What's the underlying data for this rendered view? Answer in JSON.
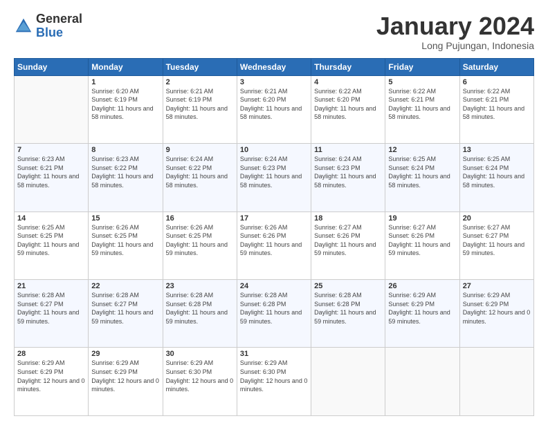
{
  "header": {
    "logo_general": "General",
    "logo_blue": "Blue",
    "month_title": "January 2024",
    "location": "Long Pujungan, Indonesia"
  },
  "days_of_week": [
    "Sunday",
    "Monday",
    "Tuesday",
    "Wednesday",
    "Thursday",
    "Friday",
    "Saturday"
  ],
  "weeks": [
    [
      {
        "day": "",
        "sunrise": "",
        "sunset": "",
        "daylight": ""
      },
      {
        "day": "1",
        "sunrise": "Sunrise: 6:20 AM",
        "sunset": "Sunset: 6:19 PM",
        "daylight": "Daylight: 11 hours and 58 minutes."
      },
      {
        "day": "2",
        "sunrise": "Sunrise: 6:21 AM",
        "sunset": "Sunset: 6:19 PM",
        "daylight": "Daylight: 11 hours and 58 minutes."
      },
      {
        "day": "3",
        "sunrise": "Sunrise: 6:21 AM",
        "sunset": "Sunset: 6:20 PM",
        "daylight": "Daylight: 11 hours and 58 minutes."
      },
      {
        "day": "4",
        "sunrise": "Sunrise: 6:22 AM",
        "sunset": "Sunset: 6:20 PM",
        "daylight": "Daylight: 11 hours and 58 minutes."
      },
      {
        "day": "5",
        "sunrise": "Sunrise: 6:22 AM",
        "sunset": "Sunset: 6:21 PM",
        "daylight": "Daylight: 11 hours and 58 minutes."
      },
      {
        "day": "6",
        "sunrise": "Sunrise: 6:22 AM",
        "sunset": "Sunset: 6:21 PM",
        "daylight": "Daylight: 11 hours and 58 minutes."
      }
    ],
    [
      {
        "day": "7",
        "sunrise": "Sunrise: 6:23 AM",
        "sunset": "Sunset: 6:21 PM",
        "daylight": "Daylight: 11 hours and 58 minutes."
      },
      {
        "day": "8",
        "sunrise": "Sunrise: 6:23 AM",
        "sunset": "Sunset: 6:22 PM",
        "daylight": "Daylight: 11 hours and 58 minutes."
      },
      {
        "day": "9",
        "sunrise": "Sunrise: 6:24 AM",
        "sunset": "Sunset: 6:22 PM",
        "daylight": "Daylight: 11 hours and 58 minutes."
      },
      {
        "day": "10",
        "sunrise": "Sunrise: 6:24 AM",
        "sunset": "Sunset: 6:23 PM",
        "daylight": "Daylight: 11 hours and 58 minutes."
      },
      {
        "day": "11",
        "sunrise": "Sunrise: 6:24 AM",
        "sunset": "Sunset: 6:23 PM",
        "daylight": "Daylight: 11 hours and 58 minutes."
      },
      {
        "day": "12",
        "sunrise": "Sunrise: 6:25 AM",
        "sunset": "Sunset: 6:24 PM",
        "daylight": "Daylight: 11 hours and 58 minutes."
      },
      {
        "day": "13",
        "sunrise": "Sunrise: 6:25 AM",
        "sunset": "Sunset: 6:24 PM",
        "daylight": "Daylight: 11 hours and 58 minutes."
      }
    ],
    [
      {
        "day": "14",
        "sunrise": "Sunrise: 6:25 AM",
        "sunset": "Sunset: 6:25 PM",
        "daylight": "Daylight: 11 hours and 59 minutes."
      },
      {
        "day": "15",
        "sunrise": "Sunrise: 6:26 AM",
        "sunset": "Sunset: 6:25 PM",
        "daylight": "Daylight: 11 hours and 59 minutes."
      },
      {
        "day": "16",
        "sunrise": "Sunrise: 6:26 AM",
        "sunset": "Sunset: 6:25 PM",
        "daylight": "Daylight: 11 hours and 59 minutes."
      },
      {
        "day": "17",
        "sunrise": "Sunrise: 6:26 AM",
        "sunset": "Sunset: 6:26 PM",
        "daylight": "Daylight: 11 hours and 59 minutes."
      },
      {
        "day": "18",
        "sunrise": "Sunrise: 6:27 AM",
        "sunset": "Sunset: 6:26 PM",
        "daylight": "Daylight: 11 hours and 59 minutes."
      },
      {
        "day": "19",
        "sunrise": "Sunrise: 6:27 AM",
        "sunset": "Sunset: 6:26 PM",
        "daylight": "Daylight: 11 hours and 59 minutes."
      },
      {
        "day": "20",
        "sunrise": "Sunrise: 6:27 AM",
        "sunset": "Sunset: 6:27 PM",
        "daylight": "Daylight: 11 hours and 59 minutes."
      }
    ],
    [
      {
        "day": "21",
        "sunrise": "Sunrise: 6:28 AM",
        "sunset": "Sunset: 6:27 PM",
        "daylight": "Daylight: 11 hours and 59 minutes."
      },
      {
        "day": "22",
        "sunrise": "Sunrise: 6:28 AM",
        "sunset": "Sunset: 6:27 PM",
        "daylight": "Daylight: 11 hours and 59 minutes."
      },
      {
        "day": "23",
        "sunrise": "Sunrise: 6:28 AM",
        "sunset": "Sunset: 6:28 PM",
        "daylight": "Daylight: 11 hours and 59 minutes."
      },
      {
        "day": "24",
        "sunrise": "Sunrise: 6:28 AM",
        "sunset": "Sunset: 6:28 PM",
        "daylight": "Daylight: 11 hours and 59 minutes."
      },
      {
        "day": "25",
        "sunrise": "Sunrise: 6:28 AM",
        "sunset": "Sunset: 6:28 PM",
        "daylight": "Daylight: 11 hours and 59 minutes."
      },
      {
        "day": "26",
        "sunrise": "Sunrise: 6:29 AM",
        "sunset": "Sunset: 6:29 PM",
        "daylight": "Daylight: 11 hours and 59 minutes."
      },
      {
        "day": "27",
        "sunrise": "Sunrise: 6:29 AM",
        "sunset": "Sunset: 6:29 PM",
        "daylight": "Daylight: 12 hours and 0 minutes."
      }
    ],
    [
      {
        "day": "28",
        "sunrise": "Sunrise: 6:29 AM",
        "sunset": "Sunset: 6:29 PM",
        "daylight": "Daylight: 12 hours and 0 minutes."
      },
      {
        "day": "29",
        "sunrise": "Sunrise: 6:29 AM",
        "sunset": "Sunset: 6:29 PM",
        "daylight": "Daylight: 12 hours and 0 minutes."
      },
      {
        "day": "30",
        "sunrise": "Sunrise: 6:29 AM",
        "sunset": "Sunset: 6:30 PM",
        "daylight": "Daylight: 12 hours and 0 minutes."
      },
      {
        "day": "31",
        "sunrise": "Sunrise: 6:29 AM",
        "sunset": "Sunset: 6:30 PM",
        "daylight": "Daylight: 12 hours and 0 minutes."
      },
      {
        "day": "",
        "sunrise": "",
        "sunset": "",
        "daylight": ""
      },
      {
        "day": "",
        "sunrise": "",
        "sunset": "",
        "daylight": ""
      },
      {
        "day": "",
        "sunrise": "",
        "sunset": "",
        "daylight": ""
      }
    ]
  ]
}
